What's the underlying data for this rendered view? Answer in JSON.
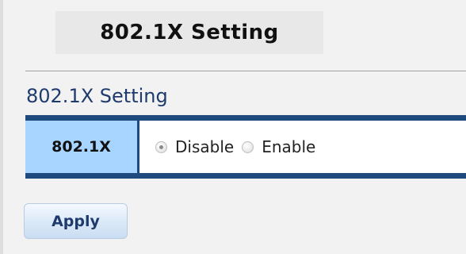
{
  "header": {
    "title": "802.1X Setting"
  },
  "section": {
    "title": "802.1X Setting"
  },
  "setting": {
    "label": "802.1X",
    "options": [
      {
        "label": "Disable",
        "selected": true
      },
      {
        "label": "Enable",
        "selected": false
      }
    ]
  },
  "actions": {
    "apply_label": "Apply"
  },
  "colors": {
    "header_bar": "#1e4a7e",
    "label_cell": "#a7d5ff",
    "section_title": "#1f3b6e"
  }
}
